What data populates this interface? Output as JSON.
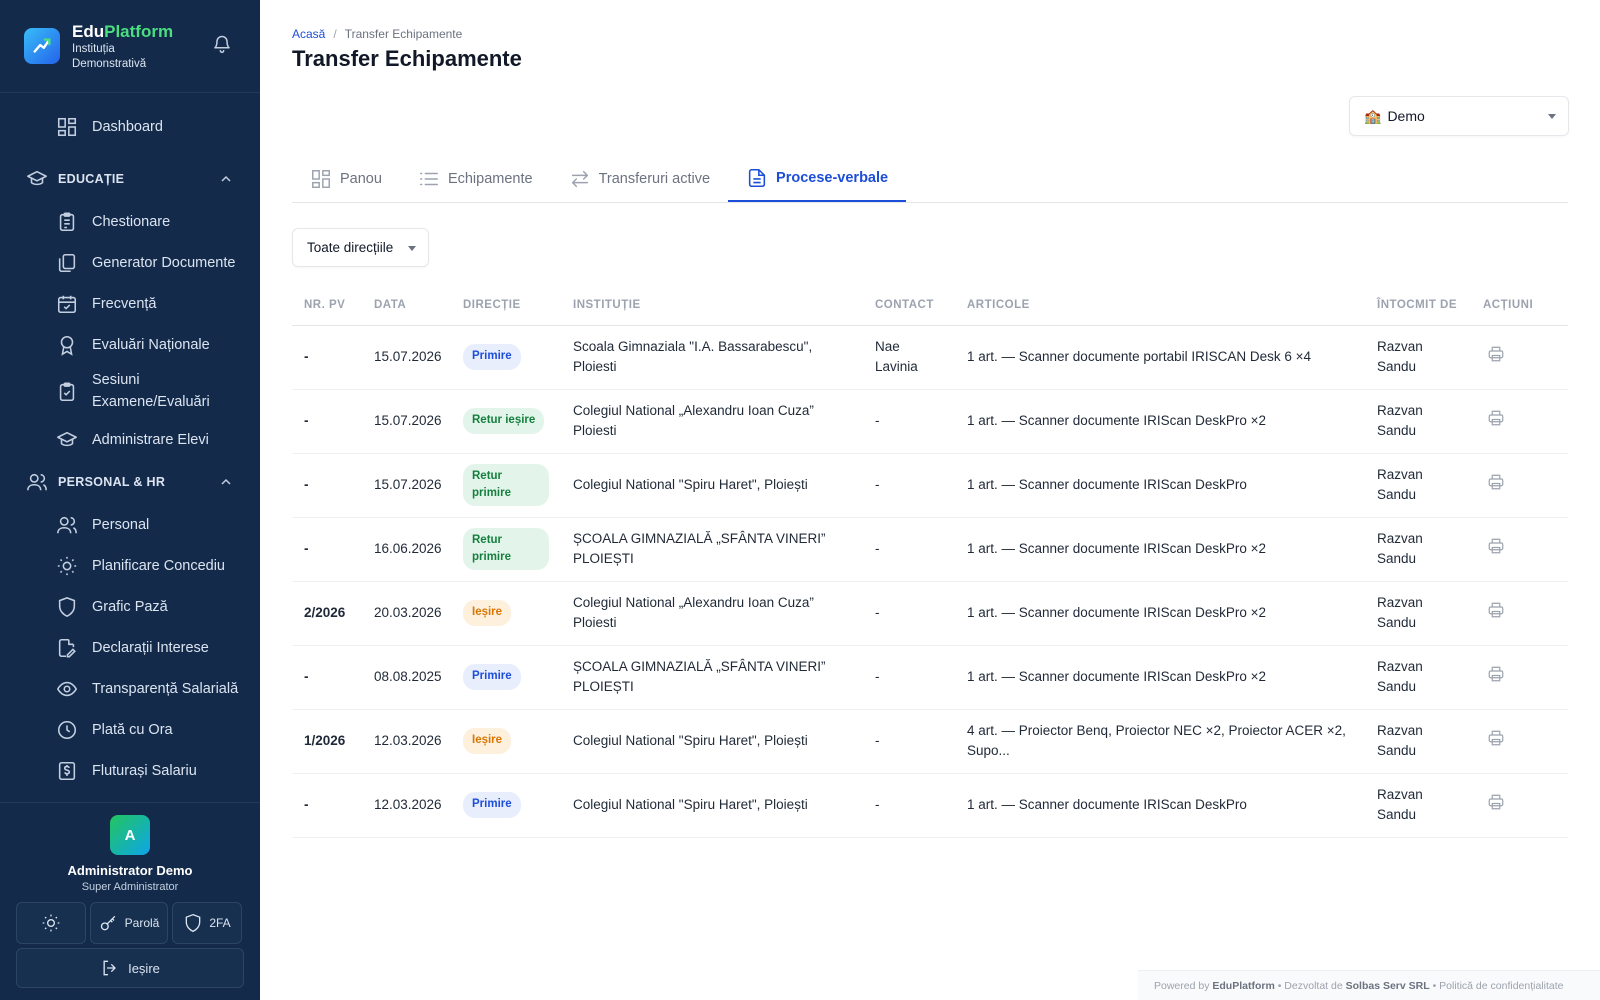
{
  "brand": {
    "name_part1": "Edu",
    "name_part2": "Platform",
    "subtitle": "Instituția Demonstrativă"
  },
  "sidebar": {
    "dashboard": "Dashboard",
    "sections": [
      {
        "label": "EDUCAȚIE",
        "items": [
          "Chestionare",
          "Generator Documente",
          "Frecvență",
          "Evaluări Naționale",
          "Sesiuni Examene/Evaluări",
          "Administrare Elevi"
        ]
      },
      {
        "label": "PERSONAL & HR",
        "items": [
          "Personal",
          "Planificare Concediu",
          "Grafic Pază",
          "Declarații Interese",
          "Transparență Salarială",
          "Plată cu Ora",
          "Fluturași Salariu"
        ]
      }
    ]
  },
  "user": {
    "initial": "A",
    "name": "Administrator Demo",
    "role": "Super Administrator"
  },
  "user_buttons": {
    "password": "Parolă",
    "twofa": "2FA",
    "logout": "Ieșire"
  },
  "breadcrumb": {
    "home": "Acasă",
    "separator": "/",
    "current": "Transfer Echipamente"
  },
  "page_title": "Transfer Echipamente",
  "institution_select": {
    "icon": "🏫",
    "value": "Demo"
  },
  "tabs": [
    "Panou",
    "Echipamente",
    "Transferuri active",
    "Procese-verbale"
  ],
  "filter": {
    "value": "Toate direcțiile"
  },
  "table": {
    "headers": [
      "NR. PV",
      "DATA",
      "DIRECȚIE",
      "INSTITUȚIE",
      "CONTACT",
      "ARTICOLE",
      "ÎNTOCMIT DE",
      "ACȚIUNI"
    ],
    "rows": [
      {
        "nr": "-",
        "data": "15.07.2026",
        "directie": "Primire",
        "institutie": "Scoala Gimnaziala \"I.A. Bassarabescu\", Ploiesti",
        "contact": "Nae Lavinia",
        "articole": "1 art. — Scanner documente portabil IRISCAN Desk 6 ×4",
        "intocmit": "Razvan Sandu"
      },
      {
        "nr": "-",
        "data": "15.07.2026",
        "directie": "Retur ieșire",
        "institutie": "Colegiul National „Alexandru Ioan Cuza” Ploiesti",
        "contact": "-",
        "articole": "1 art. — Scanner documente IRIScan DeskPro ×2",
        "intocmit": "Razvan Sandu"
      },
      {
        "nr": "-",
        "data": "15.07.2026",
        "directie": "Retur primire",
        "institutie": "Colegiul National \"Spiru Haret\", Ploiești",
        "contact": "-",
        "articole": "1 art. — Scanner documente IRIScan DeskPro",
        "intocmit": "Razvan Sandu"
      },
      {
        "nr": "-",
        "data": "16.06.2026",
        "directie": "Retur primire",
        "institutie": "ȘCOALA GIMNAZIALĂ „SFÂNTA VINERI” PLOIEȘTI",
        "contact": "-",
        "articole": "1 art. — Scanner documente IRIScan DeskPro ×2",
        "intocmit": "Razvan Sandu"
      },
      {
        "nr": "2/2026",
        "data": "20.03.2026",
        "directie": "Ieșire",
        "institutie": "Colegiul National „Alexandru Ioan Cuza” Ploiesti",
        "contact": "-",
        "articole": "1 art. — Scanner documente IRIScan DeskPro ×2",
        "intocmit": "Razvan Sandu"
      },
      {
        "nr": "-",
        "data": "08.08.2025",
        "directie": "Primire",
        "institutie": "ȘCOALA GIMNAZIALĂ „SFÂNTA VINERI” PLOIEȘTI",
        "contact": "-",
        "articole": "1 art. — Scanner documente IRIScan DeskPro ×2",
        "intocmit": "Razvan Sandu"
      },
      {
        "nr": "1/2026",
        "data": "12.03.2026",
        "directie": "Ieșire",
        "institutie": "Colegiul National \"Spiru Haret\", Ploiești",
        "contact": "-",
        "articole": "4 art. — Proiector Benq, Proiector NEC ×2, Proiector ACER ×2, Supo...",
        "intocmit": "Razvan Sandu"
      },
      {
        "nr": "-",
        "data": "12.03.2026",
        "directie": "Primire",
        "institutie": "Colegiul National \"Spiru Haret\", Ploiești",
        "contact": "-",
        "articole": "1 art. — Scanner documente IRIScan DeskPro",
        "intocmit": "Razvan Sandu"
      }
    ]
  },
  "badge_colors": {
    "Primire": "blue",
    "Retur ieșire": "green",
    "Retur primire": "green",
    "Ieșire": "orange"
  },
  "colors": {
    "sidebar_bg": "#132a4a",
    "accent": "#1d4ed8",
    "brand_green": "#4ade80"
  },
  "footer": {
    "powered_by": "Powered by",
    "brand": "EduPlatform",
    "dev_by": "• Dezvoltat de",
    "company": "Solbas Serv SRL",
    "privacy": "• Politică de confidențialitate"
  }
}
